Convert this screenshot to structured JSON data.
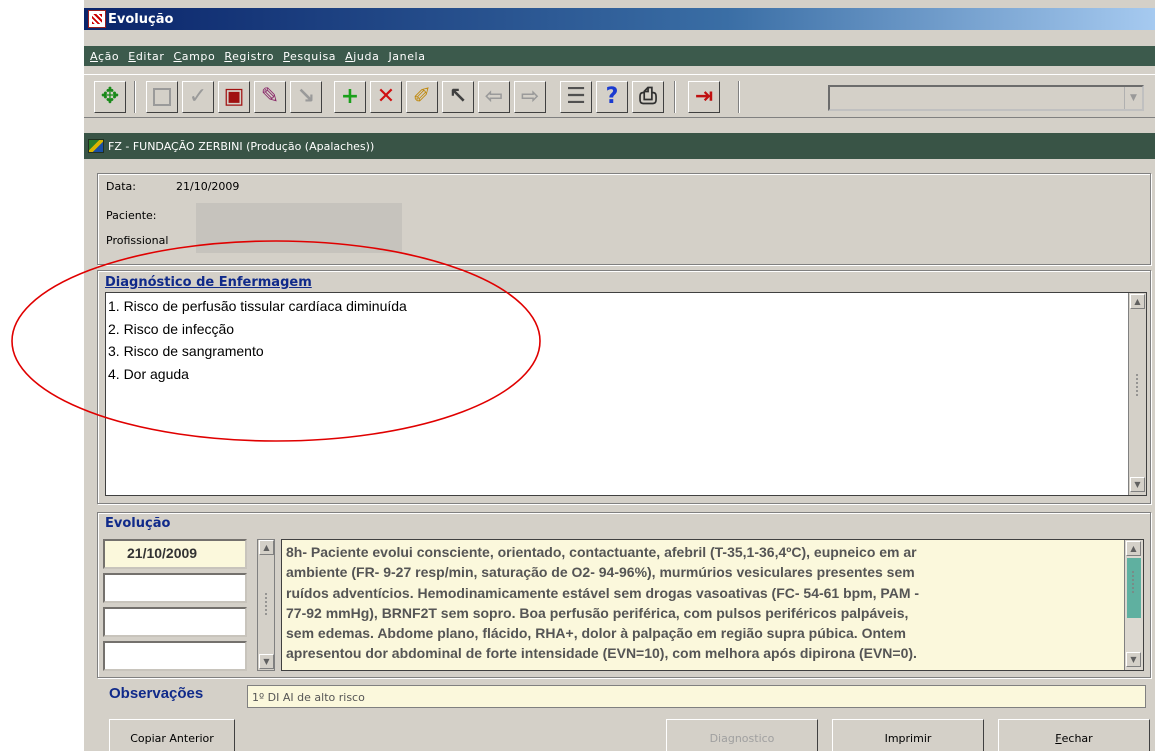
{
  "window": {
    "title": "Evolução",
    "app_icon": "oracle-forms-icon"
  },
  "menu": [
    {
      "key": "A",
      "rest": "ção"
    },
    {
      "key": "E",
      "rest": "ditar"
    },
    {
      "key": "C",
      "rest": "ampo"
    },
    {
      "key": "R",
      "rest": "egistro"
    },
    {
      "key": "P",
      "rest": "esquisa"
    },
    {
      "key": "A",
      "rest": "juda"
    },
    {
      "key": "",
      "rest": "Janela"
    }
  ],
  "toolbar": {
    "icons": [
      "move-icon",
      "save-icon",
      "accept-icon",
      "print-form-icon",
      "query-icon",
      "query-disabled-icon",
      "insert-record-icon",
      "delete-record-icon",
      "edit-icon",
      "clear-icon",
      "prev-icon",
      "next-icon",
      "list-icon",
      "help-icon",
      "print-icon",
      "exit-icon"
    ],
    "combo_value": ""
  },
  "subheader": {
    "text": "FZ - FUNDAÇÃO ZERBINI (Produção (Apalaches))"
  },
  "header": {
    "date_label": "Data:",
    "date_value": "21/10/2009",
    "patient_label": "Paciente:",
    "professional_label": "Profissional"
  },
  "diagnosis": {
    "title": "Diagnóstico de Enfermagem",
    "items": [
      "1. Risco de perfusão tissular cardíaca diminuída",
      "2. Risco de infecção",
      "3. Risco de sangramento",
      "4. Dor aguda"
    ]
  },
  "evolution": {
    "title": "Evolução",
    "dates": [
      "21/10/2009",
      "",
      "",
      ""
    ],
    "lines": [
      "8h- Paciente evolui consciente, orientado, contactuante, afebril (T-35,1-36,4ºC), eupneico em ar",
      "ambiente (FR- 9-27 resp/min, saturação de O2- 94-96%), murmúrios vesiculares presentes sem",
      "ruídos adventícios. Hemodinamicamente estável sem drogas vasoativas (FC- 54-61 bpm, PAM -",
      "77-92 mmHg), BRNF2T sem sopro. Boa perfusão periférica, com pulsos periféricos palpáveis,",
      "sem edemas. Abdome plano, flácido, RHA+, dolor à palpação em região supra púbica. Ontem",
      "apresentou dor abdominal de forte intensidade (EVN=10), com melhora após dipirona (EVN=0)."
    ]
  },
  "observations": {
    "label": "Observações",
    "value": "1º DI AI de alto risco"
  },
  "buttons": {
    "copy_previous": "Copiar Anterior",
    "diagnostic": "Diagnostico",
    "print": "Imprimir",
    "close_key": "F",
    "close_rest": "echar"
  },
  "colors": {
    "title_gradient_start": "#0a246a",
    "menubar_bg": "#3c5a4c",
    "section_title": "#102a8a",
    "annotation_ellipse": "#e00000",
    "text_field_bg": "#fbf8dc"
  }
}
